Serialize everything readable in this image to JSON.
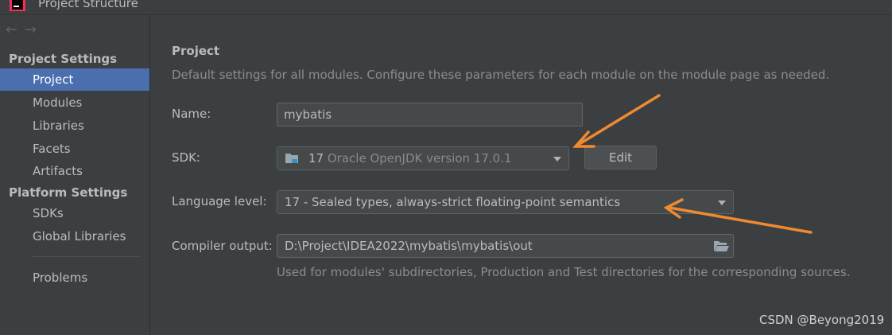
{
  "window": {
    "title": "Project Structure",
    "logo_icon": "intellij-logo-icon"
  },
  "sidebar": {
    "back_icon": "arrow-left-icon",
    "forward_icon": "arrow-right-icon",
    "sections": [
      {
        "header": "Project Settings",
        "items": [
          {
            "label": "Project",
            "selected": true
          },
          {
            "label": "Modules"
          },
          {
            "label": "Libraries"
          },
          {
            "label": "Facets"
          },
          {
            "label": "Artifacts"
          }
        ]
      },
      {
        "header": "Platform Settings",
        "items": [
          {
            "label": "SDKs"
          },
          {
            "label": "Global Libraries"
          }
        ]
      }
    ],
    "extra_items": [
      {
        "label": "Problems"
      }
    ]
  },
  "main": {
    "title": "Project",
    "description": "Default settings for all modules. Configure these parameters for each module on the module page as needed.",
    "name": {
      "label": "Name:",
      "value": "mybatis"
    },
    "sdk": {
      "label": "SDK:",
      "version": "17",
      "description": "Oracle OpenJDK version 17.0.1",
      "icon": "jdk-folder-icon",
      "edit_label": "Edit"
    },
    "language_level": {
      "label": "Language level:",
      "value": "17 - Sealed types, always-strict floating-point semantics"
    },
    "compiler_output": {
      "label": "Compiler output:",
      "value": "D:\\Project\\IDEA2022\\mybatis\\mybatis\\out",
      "hint": "Used for modules' subdirectories, Production and Test directories for the corresponding sources.",
      "browse_icon": "folder-open-icon"
    }
  },
  "annotations": {
    "color": "#f08a30"
  },
  "watermark": "CSDN @Beyong2019",
  "colors": {
    "background": "#3c3f41",
    "selection": "#4b6eaf",
    "field_background": "#45494a",
    "text": "#bbbbbb"
  }
}
